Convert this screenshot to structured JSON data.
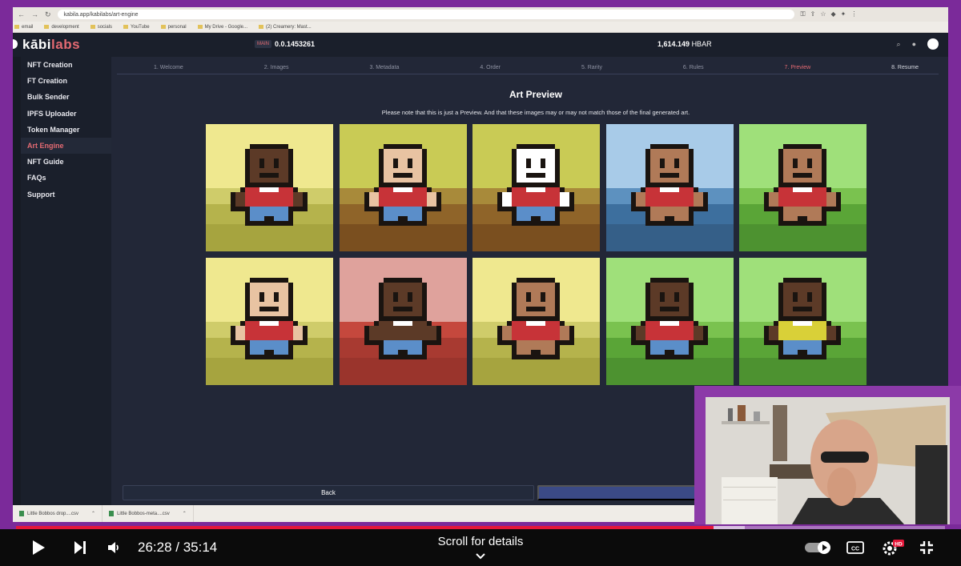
{
  "browser": {
    "url": "kabila.app/kabilabs/art-engine",
    "bookmarks": [
      "email",
      "development",
      "socials",
      "YouTube",
      "personal",
      "My Drive - Google...",
      "(2) Creamery: Mast..."
    ]
  },
  "header": {
    "logo_prefix": "kābi",
    "logo_suffix": "labs",
    "network_badge": "MAIN",
    "account_id": "0.0.1453261",
    "balance_value": "1,614.149",
    "balance_unit": "HBAR"
  },
  "sidebar": {
    "items": [
      {
        "label": "NFT Creation",
        "active": false
      },
      {
        "label": "FT Creation",
        "active": false
      },
      {
        "label": "Bulk Sender",
        "active": false
      },
      {
        "label": "IPFS Uploader",
        "active": false
      },
      {
        "label": "Token Manager",
        "active": false
      },
      {
        "label": "Art Engine",
        "active": true
      },
      {
        "label": "NFT Guide",
        "active": false
      },
      {
        "label": "FAQs",
        "active": false
      },
      {
        "label": "Support",
        "active": false
      }
    ]
  },
  "steps": [
    "1. Welcome",
    "2. Images",
    "3. Metadata",
    "4. Order",
    "5. Rarity",
    "6. Rules",
    "7. Preview",
    "8. Resume"
  ],
  "current_step": 6,
  "preview": {
    "title": "Art Preview",
    "note": "Please note that this is just a Preview. And that these images may or may not match those of the final generated art.",
    "tiles": [
      {
        "sky": "#efe88f",
        "b1": "#cfcc6a",
        "b2": "#b5b34c",
        "b3": "#a6a43f",
        "skin": "#5c3a27",
        "shirt": "#c73338",
        "pants": "#5b8ec9"
      },
      {
        "sky": "#c9cb55",
        "b1": "#a88a3a",
        "b2": "#8f6429",
        "b3": "#7a4f1f",
        "skin": "#e8c3a2",
        "shirt": "#c73338",
        "pants": "#5b8ec9"
      },
      {
        "sky": "#c9cb55",
        "b1": "#a88a3a",
        "b2": "#8f6429",
        "b3": "#7a4f1f",
        "skin": "#ffffff",
        "shirt": "#c73338",
        "pants": "#5b8ec9"
      },
      {
        "sky": "#a8cbe8",
        "b1": "#5d91bf",
        "b2": "#3d6f9e",
        "b3": "#355f88",
        "skin": "#b07a58",
        "shirt": "#c73338",
        "pants": "#b07a58"
      },
      {
        "sky": "#9fe07a",
        "b1": "#7ac24f",
        "b2": "#5aa537",
        "b3": "#4d9230",
        "skin": "#b07a58",
        "shirt": "#c73338",
        "pants": "#b07a58"
      },
      {
        "sky": "#efe88f",
        "b1": "#cfcc6a",
        "b2": "#b5b34c",
        "b3": "#a6a43f",
        "skin": "#e8c3a2",
        "shirt": "#c73338",
        "pants": "#5b8ec9"
      },
      {
        "sky": "#dfa29c",
        "b1": "#c5483d",
        "b2": "#a83a31",
        "b3": "#9a342c",
        "skin": "#5c3a27",
        "shirt": "#5c3a27",
        "pants": "#5b8ec9"
      },
      {
        "sky": "#efe88f",
        "b1": "#cfcc6a",
        "b2": "#b5b34c",
        "b3": "#a6a43f",
        "skin": "#b07a58",
        "shirt": "#c73338",
        "pants": "#b07a58"
      },
      {
        "sky": "#9fe07a",
        "b1": "#7ac24f",
        "b2": "#5aa537",
        "b3": "#4d9230",
        "skin": "#5c3a27",
        "shirt": "#c73338",
        "pants": "#5b8ec9"
      },
      {
        "sky": "#9fe07a",
        "b1": "#7ac24f",
        "b2": "#5aa537",
        "b3": "#4d9230",
        "skin": "#5c3a27",
        "shirt": "#d9d038",
        "pants": "#5b8ec9"
      }
    ]
  },
  "buttons": {
    "back": "Back"
  },
  "downloads": [
    {
      "name": "Little Bobbos drop....csv"
    },
    {
      "name": "Little Bobbos-meta....csv"
    }
  ],
  "player": {
    "current_time": "26:28",
    "separator": " / ",
    "duration": "35:14",
    "played_fraction": 0.751,
    "scroll_hint": "Scroll for details",
    "hd_badge": "HD",
    "brand_color": "#e5173a"
  },
  "colors": {
    "accent": "#e46a72",
    "background": "#222737",
    "frame": "#7b2a9a"
  }
}
